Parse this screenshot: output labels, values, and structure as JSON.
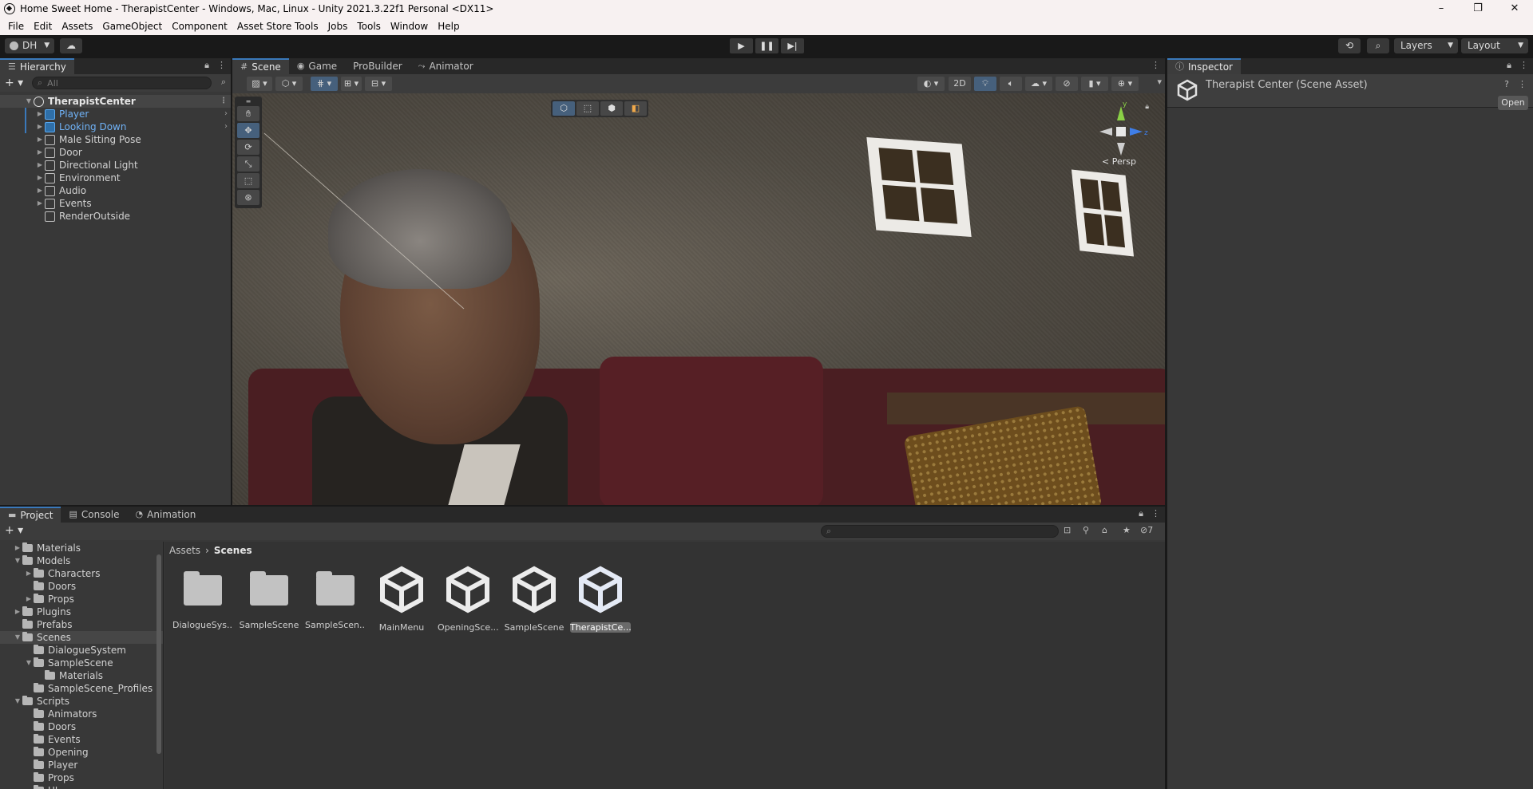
{
  "window": {
    "title": "Home Sweet Home - TherapistCenter - Windows, Mac, Linux - Unity 2021.3.22f1 Personal <DX11>",
    "minimize": "–",
    "maximize": "❐",
    "close": "✕"
  },
  "menu": [
    "File",
    "Edit",
    "Assets",
    "GameObject",
    "Component",
    "Asset Store Tools",
    "Jobs",
    "Tools",
    "Window",
    "Help"
  ],
  "toolbar": {
    "account": "DH",
    "layers": "Layers",
    "layout": "Layout",
    "play": "▶",
    "pause": "❚❚",
    "step": "▶|"
  },
  "hierarchy": {
    "tab": "Hierarchy",
    "search_placeholder": "All",
    "scene": "TherapistCenter",
    "items": [
      {
        "label": "Player",
        "prefab": true,
        "expandable": true
      },
      {
        "label": "Looking Down",
        "prefab": true,
        "expandable": true
      },
      {
        "label": "Male Sitting Pose",
        "prefab": false,
        "expandable": true
      },
      {
        "label": "Door",
        "prefab": false,
        "expandable": true
      },
      {
        "label": "Directional Light",
        "prefab": false,
        "expandable": true
      },
      {
        "label": "Environment",
        "prefab": false,
        "expandable": true
      },
      {
        "label": "Audio",
        "prefab": false,
        "expandable": true
      },
      {
        "label": "Events",
        "prefab": false,
        "expandable": true
      },
      {
        "label": "RenderOutside",
        "prefab": false,
        "expandable": false
      }
    ]
  },
  "scene": {
    "tabs": [
      "Scene",
      "Game",
      "ProBuilder",
      "Animator"
    ],
    "active_tab": "Scene",
    "btn_2d": "2D",
    "persp": "< Persp",
    "axis_y": "y",
    "axis_z": "z"
  },
  "inspector": {
    "tab": "Inspector",
    "title": "Therapist Center (Scene Asset)",
    "open": "Open"
  },
  "project": {
    "tabs": [
      "Project",
      "Console",
      "Animation"
    ],
    "hidden_count": "7",
    "breadcrumb": [
      "Assets",
      "Scenes"
    ],
    "tree": [
      {
        "label": "Materials",
        "depth": 1,
        "tri": "▶"
      },
      {
        "label": "Models",
        "depth": 1,
        "tri": "▼"
      },
      {
        "label": "Characters",
        "depth": 2,
        "tri": "▶"
      },
      {
        "label": "Doors",
        "depth": 2,
        "tri": ""
      },
      {
        "label": "Props",
        "depth": 2,
        "tri": "▶"
      },
      {
        "label": "Plugins",
        "depth": 1,
        "tri": "▶"
      },
      {
        "label": "Prefabs",
        "depth": 1,
        "tri": ""
      },
      {
        "label": "Scenes",
        "depth": 1,
        "tri": "▼",
        "selected": true
      },
      {
        "label": "DialogueSystem",
        "depth": 2,
        "tri": ""
      },
      {
        "label": "SampleScene",
        "depth": 2,
        "tri": "▼"
      },
      {
        "label": "Materials",
        "depth": 3,
        "tri": ""
      },
      {
        "label": "SampleScene_Profiles",
        "depth": 2,
        "tri": ""
      },
      {
        "label": "Scripts",
        "depth": 1,
        "tri": "▼"
      },
      {
        "label": "Animators",
        "depth": 2,
        "tri": ""
      },
      {
        "label": "Doors",
        "depth": 2,
        "tri": ""
      },
      {
        "label": "Events",
        "depth": 2,
        "tri": ""
      },
      {
        "label": "Opening",
        "depth": 2,
        "tri": ""
      },
      {
        "label": "Player",
        "depth": 2,
        "tri": ""
      },
      {
        "label": "Props",
        "depth": 2,
        "tri": ""
      },
      {
        "label": "UI",
        "depth": 2,
        "tri": ""
      }
    ],
    "assets": [
      {
        "label": "DialogueSys...",
        "kind": "folder"
      },
      {
        "label": "SampleScene",
        "kind": "folder"
      },
      {
        "label": "SampleScen...",
        "kind": "folder"
      },
      {
        "label": "MainMenu",
        "kind": "scene"
      },
      {
        "label": "OpeningSce...",
        "kind": "scene"
      },
      {
        "label": "SampleScene",
        "kind": "scene"
      },
      {
        "label": "TherapistCe...",
        "kind": "scene",
        "selected": true
      }
    ]
  },
  "colors": {
    "accent": "#3a79bb",
    "prefab_text": "#6fb1f5",
    "panel_bg": "#383838"
  }
}
